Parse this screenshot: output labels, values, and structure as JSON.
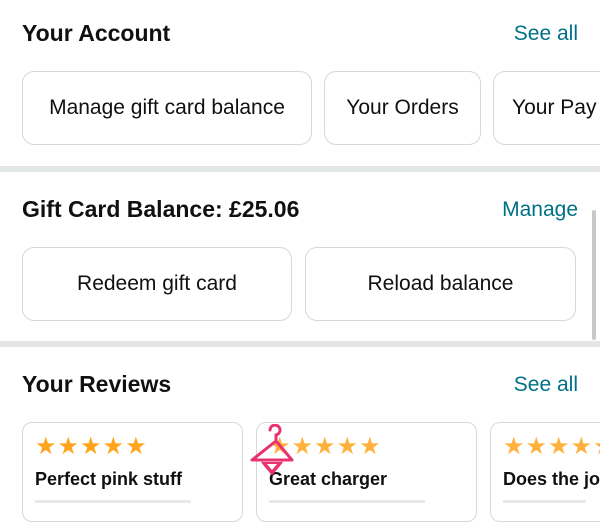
{
  "account": {
    "title": "Your Account",
    "see_all": "See all",
    "cards": [
      "Manage gift card balance",
      "Your Orders",
      "Your Pay"
    ]
  },
  "gift": {
    "title": "Gift Card Balance: £25.06",
    "manage": "Manage",
    "buttons": [
      "Redeem gift card",
      "Reload balance"
    ]
  },
  "reviews": {
    "title": "Your Reviews",
    "see_all": "See all",
    "items": [
      {
        "title": "Perfect pink stuff",
        "rating": 5
      },
      {
        "title": "Great charger",
        "rating": 5
      },
      {
        "title": "Does the jo",
        "rating": 5
      }
    ]
  },
  "colors": {
    "link": "#007185",
    "star": "#ffa41c",
    "hanger": "#e8336f"
  },
  "icons": [
    "star-icon",
    "hanger-icon"
  ]
}
